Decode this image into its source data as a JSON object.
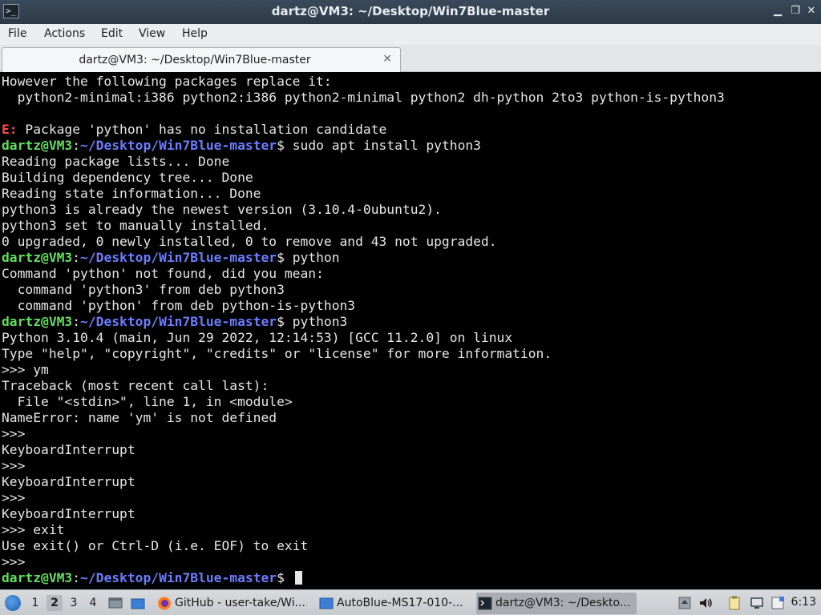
{
  "window": {
    "title": "dartz@VM3: ~/Desktop/Win7Blue-master",
    "icon": "terminal-icon",
    "controls": [
      "minimize-icon",
      "maximize-icon",
      "close-icon"
    ]
  },
  "menu": [
    "File",
    "Actions",
    "Edit",
    "View",
    "Help"
  ],
  "tab": {
    "label": "dartz@VM3: ~/Desktop/Win7Blue-master",
    "close": "×"
  },
  "terminal": {
    "prompt_user": "dartz@VM3",
    "prompt_sep": ":",
    "prompt_path": "~/Desktop/Win7Blue-master",
    "prompt_end": "$ ",
    "lines": [
      {
        "t": "out",
        "text": "However the following packages replace it:"
      },
      {
        "t": "out",
        "text": "  python2-minimal:i386 python2:i386 python2-minimal python2 dh-python 2to3 python-is-python3"
      },
      {
        "t": "out",
        "text": ""
      },
      {
        "t": "err",
        "label": "E:",
        "text": " Package 'python' has no installation candidate"
      },
      {
        "t": "prompt",
        "text": "sudo apt install python3"
      },
      {
        "t": "out",
        "text": "Reading package lists... Done"
      },
      {
        "t": "out",
        "text": "Building dependency tree... Done"
      },
      {
        "t": "out",
        "text": "Reading state information... Done"
      },
      {
        "t": "out",
        "text": "python3 is already the newest version (3.10.4-0ubuntu2)."
      },
      {
        "t": "out",
        "text": "python3 set to manually installed."
      },
      {
        "t": "out",
        "text": "0 upgraded, 0 newly installed, 0 to remove and 43 not upgraded."
      },
      {
        "t": "prompt",
        "text": "python"
      },
      {
        "t": "out",
        "text": "Command 'python' not found, did you mean:"
      },
      {
        "t": "out",
        "text": "  command 'python3' from deb python3"
      },
      {
        "t": "out",
        "text": "  command 'python' from deb python-is-python3"
      },
      {
        "t": "prompt",
        "text": "python3"
      },
      {
        "t": "out",
        "text": "Python 3.10.4 (main, Jun 29 2022, 12:14:53) [GCC 11.2.0] on linux"
      },
      {
        "t": "out",
        "text": "Type \"help\", \"copyright\", \"credits\" or \"license\" for more information."
      },
      {
        "t": "out",
        "text": ">>> ym"
      },
      {
        "t": "out",
        "text": "Traceback (most recent call last):"
      },
      {
        "t": "out",
        "text": "  File \"<stdin>\", line 1, in <module>"
      },
      {
        "t": "out",
        "text": "NameError: name 'ym' is not defined"
      },
      {
        "t": "out",
        "text": ">>>"
      },
      {
        "t": "out",
        "text": "KeyboardInterrupt"
      },
      {
        "t": "out",
        "text": ">>>"
      },
      {
        "t": "out",
        "text": "KeyboardInterrupt"
      },
      {
        "t": "out",
        "text": ">>>"
      },
      {
        "t": "out",
        "text": "KeyboardInterrupt"
      },
      {
        "t": "out",
        "text": ">>> exit"
      },
      {
        "t": "out",
        "text": "Use exit() or Ctrl-D (i.e. EOF) to exit"
      },
      {
        "t": "out",
        "text": ">>>"
      },
      {
        "t": "prompt",
        "text": "",
        "cursor": true
      }
    ]
  },
  "taskbar": {
    "workspaces": [
      "1",
      "2",
      "3",
      "4"
    ],
    "active_workspace": "2",
    "tasks": [
      {
        "label": "GitHub - user-take/Wi...",
        "icon": "firefox-icon"
      },
      {
        "label": "AutoBlue-MS17-010-...",
        "icon": "folder-icon"
      },
      {
        "label": "dartz@VM3: ~/Deskto...",
        "icon": "terminal-icon",
        "active": true
      }
    ],
    "clock": "6:13"
  },
  "colors": {
    "prompt_user": "#5fe05a",
    "prompt_path": "#6a7dff",
    "error": "#ff4a4a"
  }
}
